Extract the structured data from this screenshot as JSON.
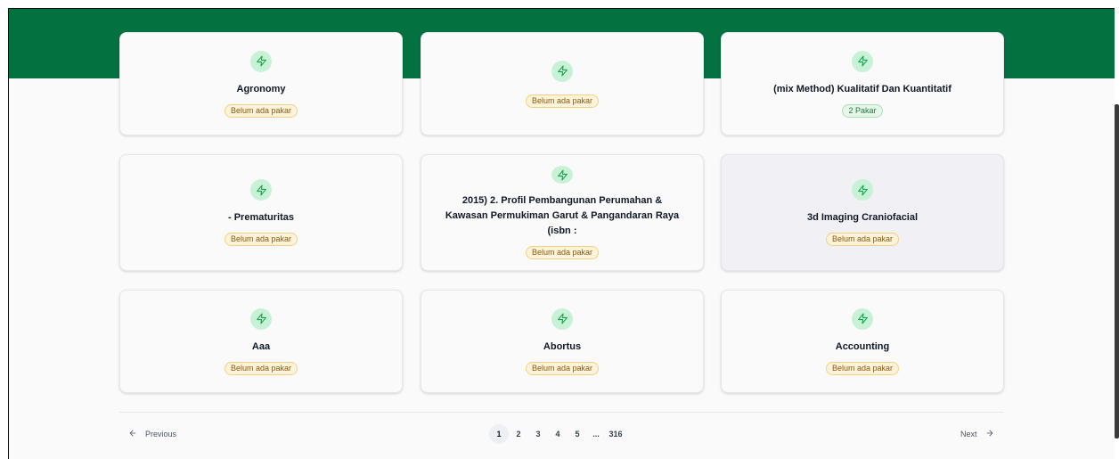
{
  "cards": [
    {
      "title": "Agronomy",
      "badge": "Belum ada pakar",
      "badge_type": "warn"
    },
    {
      "title": "",
      "badge": "Belum ada pakar",
      "badge_type": "warn"
    },
    {
      "title": "(mix Method) Kualitatif Dan Kuantitatif",
      "badge": "2 Pakar",
      "badge_type": "ok"
    },
    {
      "title": "- Prematuritas",
      "badge": "Belum ada pakar",
      "badge_type": "warn"
    },
    {
      "title": "2015) 2. Profil Pembangunan Perumahan & Kawasan Permukiman Garut & Pangandaran Raya (isbn :",
      "badge": "Belum ada pakar",
      "badge_type": "warn"
    },
    {
      "title": "3d Imaging Craniofacial",
      "badge": "Belum ada pakar",
      "badge_type": "warn"
    },
    {
      "title": "Aaa",
      "badge": "Belum ada pakar",
      "badge_type": "warn"
    },
    {
      "title": "Abortus",
      "badge": "Belum ada pakar",
      "badge_type": "warn"
    },
    {
      "title": "Accounting",
      "badge": "Belum ada pakar",
      "badge_type": "warn"
    }
  ],
  "pagination": {
    "previous_label": "Previous",
    "next_label": "Next",
    "pages": [
      "1",
      "2",
      "3",
      "4",
      "5"
    ],
    "ellipsis": "...",
    "last_page": "316",
    "current_page": "1"
  },
  "colors": {
    "header": "#047141",
    "icon_bg": "#c8f2d6",
    "icon_stroke": "#16a34a",
    "badge_warn_bg": "#fdf3d8",
    "badge_ok_bg": "#e6f7ea"
  },
  "icons": {
    "card_icon": "lightning-bolt-icon",
    "prev_icon": "arrow-left-icon",
    "next_icon": "arrow-right-icon"
  }
}
